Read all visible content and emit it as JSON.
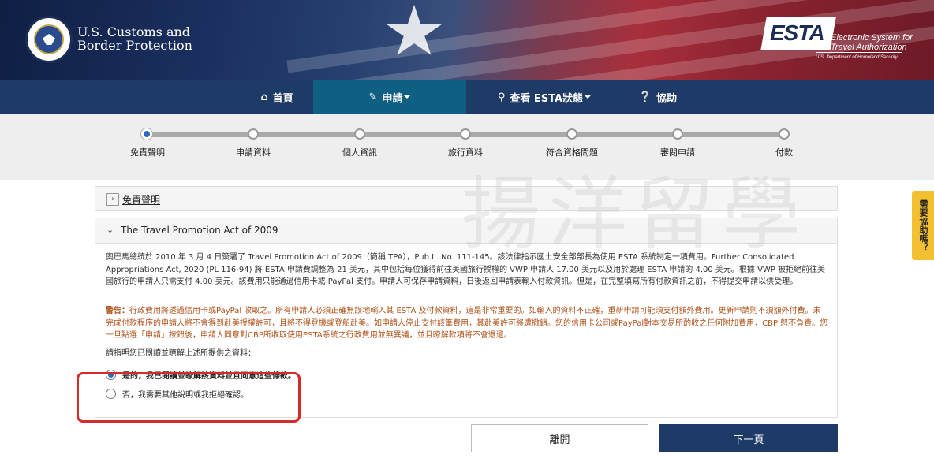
{
  "header": {
    "agency_line1": "U.S. Customs and",
    "agency_line2": "Border Protection",
    "esta_logo": "ESTA",
    "esta_desc_line1": "Electronic System for",
    "esta_desc_line2": "Travel Authorization",
    "esta_sub": "U.S. Department of Homeland Security"
  },
  "nav": {
    "items": [
      {
        "label": "首頁",
        "icon": "home-icon"
      },
      {
        "label": "申請",
        "icon": "pencil-icon"
      },
      {
        "label": "查看 ESTA狀態",
        "icon": "search-icon"
      },
      {
        "label": "協助",
        "icon": "question-icon"
      }
    ]
  },
  "steps": {
    "current": 0,
    "items": [
      "免責聲明",
      "申請資料",
      "個人資訊",
      "旅行資料",
      "符合資格問題",
      "審閱申請",
      "付款"
    ]
  },
  "accordion1": {
    "title": "免責聲明"
  },
  "accordion2": {
    "title": "The Travel Promotion Act of 2009",
    "para1": "奧巴馬總統於 2010 年 3 月 4 日簽署了 Travel Promotion Act of 2009（簡稱 TPA），Pub.L. No. 111-145。該法律指示國土安全部部長為使用 ESTA 系統制定一項費用。Further Consolidated Appropriations Act, 2020 (PL 116-94) 將 ESTA 申請費調整為 21 美元，其中包括每位獲得前往美國旅行授權的 VWP 申請人 17.00 美元以及用於處理 ESTA 申請的 4.00 美元。根據 VWP 被拒絕前往美國旅行的申請人只需支付 4.00 美元。該費用只能通過信用卡或 PayPal 支付。申請人可保存申請資料，日後返回申請表輸入付款資訊。但是，在完整填寫所有付款資訊之前，不得提交申請以供受理。",
    "warning_label": "警告：",
    "para2": "行政費用將透過信用卡或PayPal 收取之。所有申請人必須正確無誤地輸入其 ESTA 及付款資料，這是非常重要的。如輸入的資料不正確，重新申請可能須支付額外費用。更新申請則不須額外付費。未完成付款程序的申請人將不會得到赴美授權許可，且將不得登機或登船赴美。如申請人停止支付該筆費用，其赴美許可將遭撤銷。您的信用卡公司或PayPal對本交易所酌收之任何附加費用，CBP 恕不負責。您一旦點選「申請」按鈕後，申請人同意對CBP所收取使用ESTA系統之行政費用並無異議，並且瞭解款項將不會退還。",
    "para3": "請指明您已閱讀並瞭解上述所提供之資料：",
    "option_yes": "是的，我已閱讀並瞭解該資料並且同意這些條款。",
    "option_no": "否，我需要其他說明或我拒絕確認。"
  },
  "buttons": {
    "leave": "離開",
    "next": "下一頁"
  },
  "help_tab": "需要協助嗎？",
  "watermark": "揚洋留學"
}
